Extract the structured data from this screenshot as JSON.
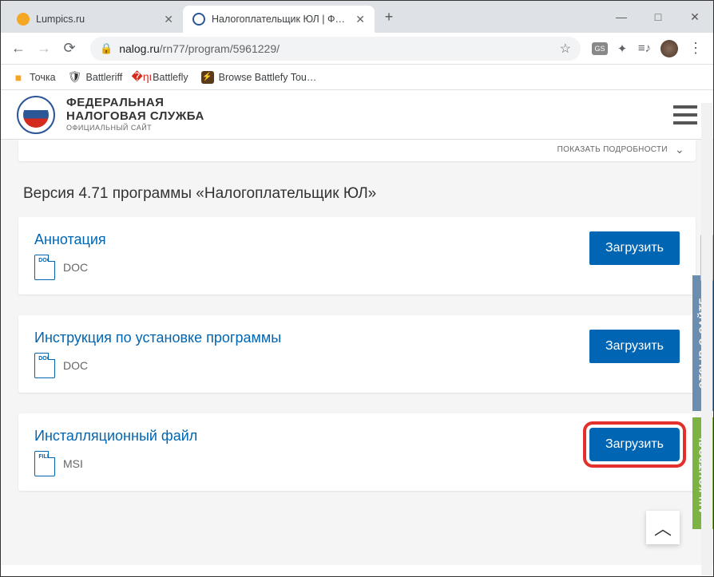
{
  "window": {
    "tabs": [
      {
        "title": "Lumpics.ru",
        "active": false,
        "favicon": "#f5a623"
      },
      {
        "title": "Налогоплательщик ЮЛ | ФНС Р",
        "active": true,
        "favicon": "#2b5797"
      }
    ]
  },
  "address": {
    "host": "nalog.ru",
    "path": "/rn77/program/5961229/"
  },
  "bookmarks": [
    {
      "label": "Точка",
      "icon_color": "#f5a623"
    },
    {
      "label": "Battleriff",
      "icon_color": "#333"
    },
    {
      "label": "Battlefly",
      "icon_color": "#d52b1e"
    },
    {
      "label": "Browse Battlefy Tou…",
      "icon_color": "#814f2a"
    }
  ],
  "site_header": {
    "line1": "ФЕДЕРАЛЬНАЯ",
    "line2": "НАЛОГОВАЯ СЛУЖБА",
    "sub": "ОФИЦИАЛЬНЫЙ САЙТ"
  },
  "details_toggle": "ПОКАЗАТЬ ПОДРОБНОСТИ",
  "version_title": "Версия 4.71 программы «Налогоплательщик ЮЛ»",
  "downloads": [
    {
      "title": "Аннотация",
      "format": "DOC",
      "icon_label": "DOC",
      "button": "Загрузить",
      "highlighted": false
    },
    {
      "title": "Инструкция по установке программы",
      "format": "DOC",
      "icon_label": "DOC",
      "button": "Загрузить",
      "highlighted": false
    },
    {
      "title": "Инсталляционный файл",
      "format": "MSI",
      "icon_label": "FILE",
      "button": "Загрузить",
      "highlighted": true
    }
  ],
  "side_tabs": {
    "blue": "ОТЗЫВ О САЙТЕ",
    "green": "АШ КОНТРОЛЬ"
  }
}
